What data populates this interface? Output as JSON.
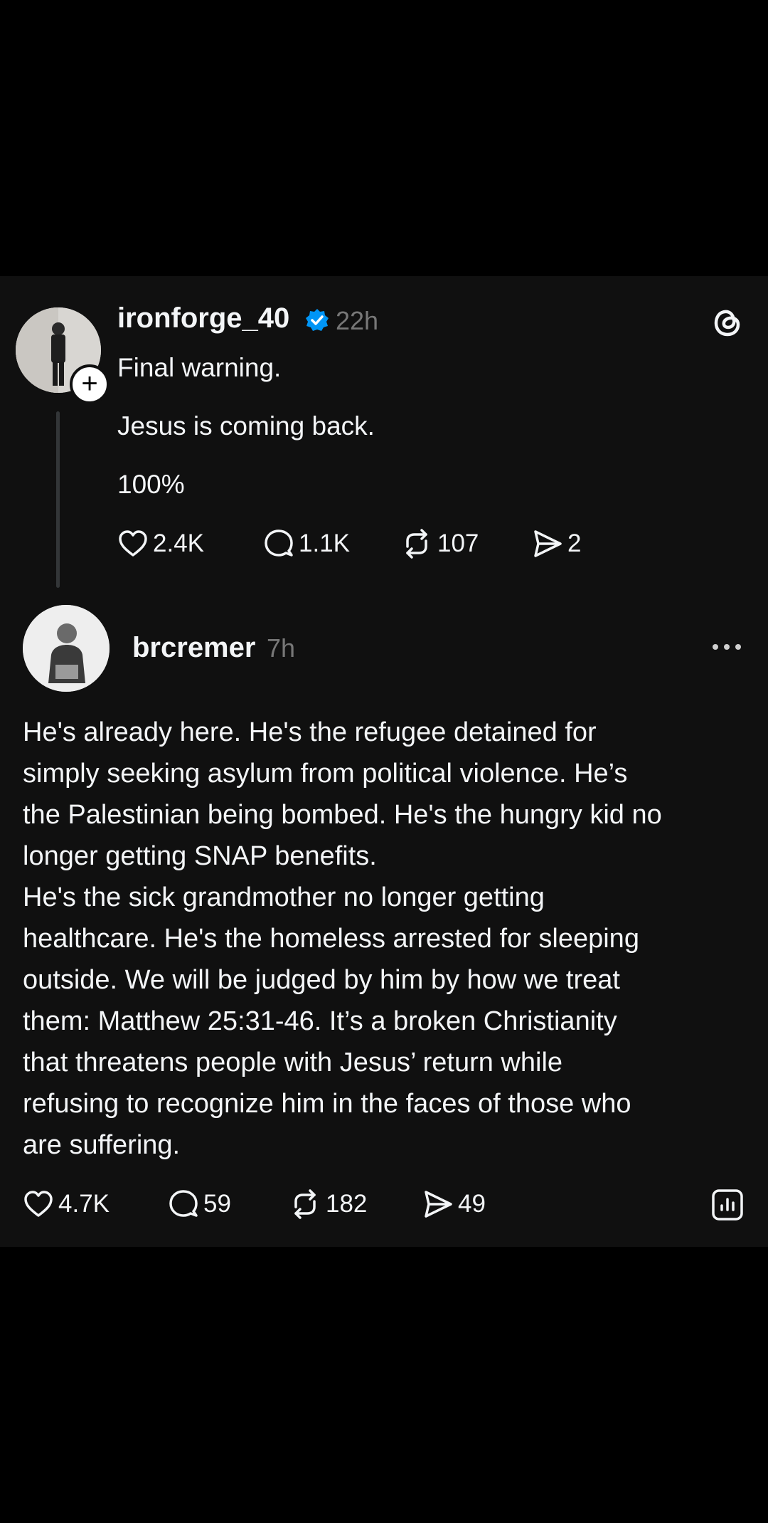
{
  "post": {
    "username": "ironforge_40",
    "time": "22h",
    "lines": [
      "Final warning.",
      "Jesus is coming back.",
      "100%"
    ],
    "likes": "2.4K",
    "replies": "1.1K",
    "reposts": "107",
    "shares": "2"
  },
  "reply": {
    "username": "brcremer",
    "time": "7h",
    "lines": [
      "He's already here. He's the refugee detained for",
      "simply seeking asylum from political violence. He’s",
      "the Palestinian being bombed. He's the hungry kid no",
      "longer getting SNAP benefits.",
      "He's the sick grandmother no longer getting",
      "healthcare. He's the homeless arrested for sleeping",
      "outside. We will be judged by him by how we treat",
      "them: Matthew 25:31-46. It’s a broken Christianity",
      "that threatens people with Jesus’ return while",
      "refusing to recognize him in the faces of those who",
      "are suffering."
    ],
    "likes": "4.7K",
    "replies": "59",
    "reposts": "182",
    "shares": "49"
  },
  "colors": {
    "card_bg": "#101010",
    "verified": "#0095f6",
    "muted": "#777777"
  }
}
